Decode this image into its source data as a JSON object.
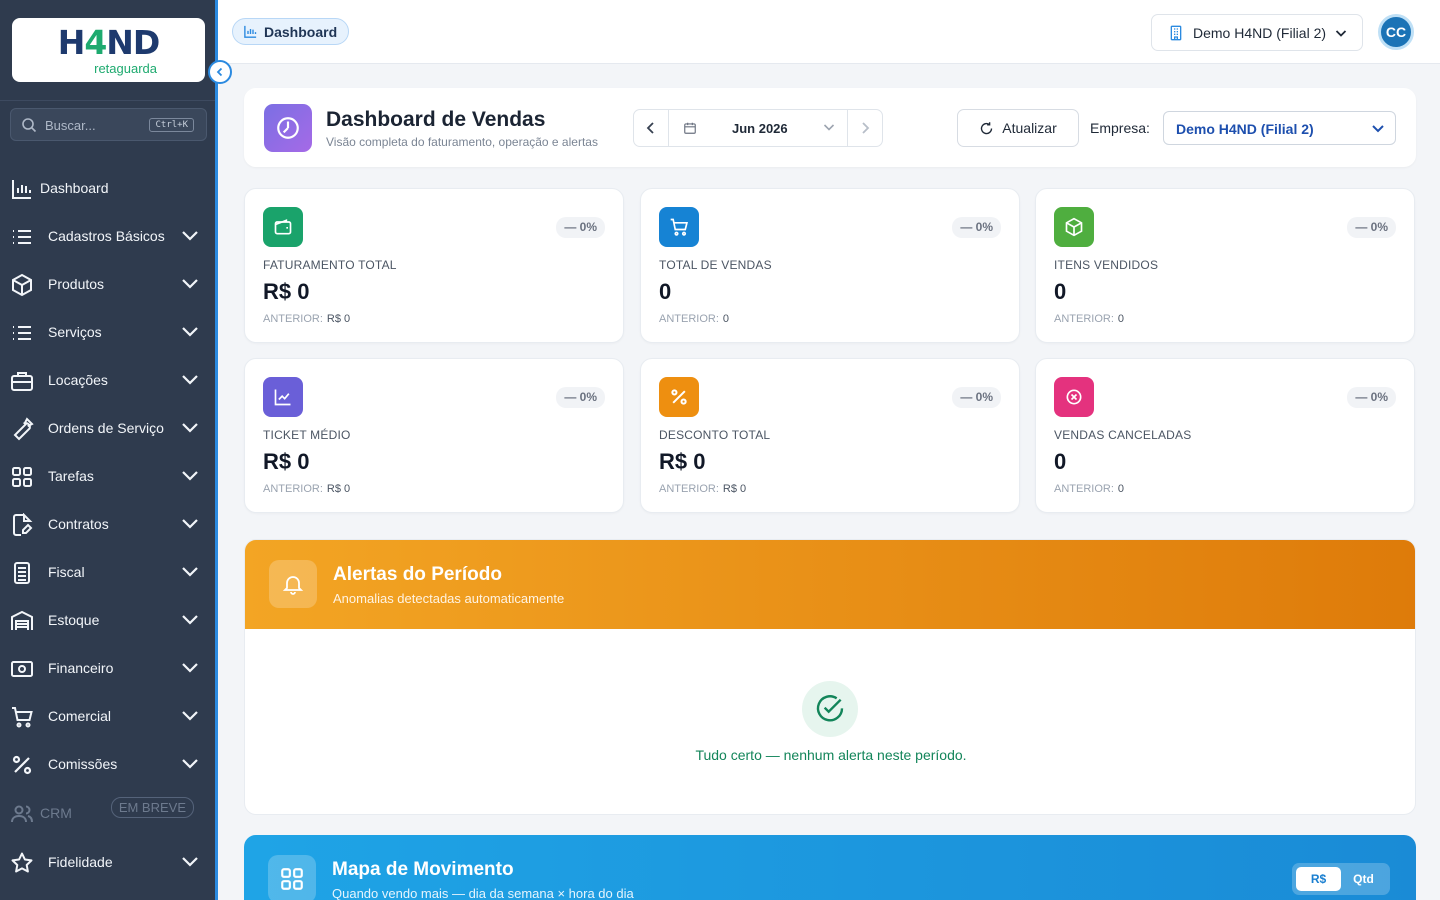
{
  "logo": {
    "main_a": "H",
    "main_b": "4",
    "main_c": "ND",
    "sub": "retaguarda"
  },
  "search": {
    "placeholder": "Buscar...",
    "shortcut": "Ctrl+K"
  },
  "sidebar": {
    "items": [
      {
        "label": "Dashboard",
        "icon": "chart-bar-icon"
      },
      {
        "label": "Cadastros Básicos",
        "icon": "list-icon"
      },
      {
        "label": "Produtos",
        "icon": "box-icon"
      },
      {
        "label": "Serviços",
        "icon": "list-icon"
      },
      {
        "label": "Locações",
        "icon": "briefcase-icon"
      },
      {
        "label": "Ordens de Serviço",
        "icon": "wrench-icon"
      },
      {
        "label": "Tarefas",
        "icon": "grid-icon"
      },
      {
        "label": "Contratos",
        "icon": "document-edit-icon"
      },
      {
        "label": "Fiscal",
        "icon": "receipt-icon"
      },
      {
        "label": "Estoque",
        "icon": "warehouse-icon"
      },
      {
        "label": "Financeiro",
        "icon": "banknote-icon"
      },
      {
        "label": "Comercial",
        "icon": "cart-icon"
      },
      {
        "label": "Comissões",
        "icon": "percent-icon"
      },
      {
        "label": "CRM",
        "icon": "users-icon",
        "badge": "EM BREVE"
      },
      {
        "label": "Fidelidade",
        "icon": "star-icon"
      }
    ]
  },
  "topbar": {
    "breadcrumb": "Dashboard",
    "branch": "Demo H4ND (Filial 2)",
    "avatar": "CC"
  },
  "header": {
    "title": "Dashboard de Vendas",
    "subtitle": "Visão completa do faturamento, operação e alertas",
    "period": "Jun 2026",
    "refresh_label": "Atualizar",
    "company_label": "Empresa:",
    "company_value": "Demo H4ND (Filial 2)"
  },
  "kpis": [
    {
      "label": "FATURAMENTO TOTAL",
      "value": "R$ 0",
      "pct": "0%",
      "prev_label": "ANTERIOR:",
      "prev": "R$ 0",
      "color": "#1aa36b",
      "icon": "wallet-icon"
    },
    {
      "label": "TOTAL DE VENDAS",
      "value": "0",
      "pct": "0%",
      "prev_label": "ANTERIOR:",
      "prev": "0",
      "color": "#1683d4",
      "icon": "cart-icon"
    },
    {
      "label": "ITENS VENDIDOS",
      "value": "0",
      "pct": "0%",
      "prev_label": "ANTERIOR:",
      "prev": "0",
      "color": "#4fae3f",
      "icon": "box-icon"
    },
    {
      "label": "TICKET MÉDIO",
      "value": "R$ 0",
      "pct": "0%",
      "prev_label": "ANTERIOR:",
      "prev": "R$ 0",
      "color": "#6a5fd8",
      "icon": "trend-chart-icon"
    },
    {
      "label": "DESCONTO TOTAL",
      "value": "R$ 0",
      "pct": "0%",
      "prev_label": "ANTERIOR:",
      "prev": "R$ 0",
      "color": "#ee8f10",
      "icon": "percent-icon"
    },
    {
      "label": "VENDAS CANCELADAS",
      "value": "0",
      "pct": "0%",
      "prev_label": "ANTERIOR:",
      "prev": "0",
      "color": "#e4327e",
      "icon": "cancel-circle-icon"
    }
  ],
  "alerts": {
    "title": "Alertas do Período",
    "subtitle": "Anomalias detectadas automaticamente",
    "empty_text": "Tudo certo — nenhum alerta neste período."
  },
  "heatmap": {
    "title": "Mapa de Movimento",
    "subtitle": "Quando vendo mais — dia da semana × hora do dia",
    "toggle": [
      "R$",
      "Qtd"
    ]
  }
}
